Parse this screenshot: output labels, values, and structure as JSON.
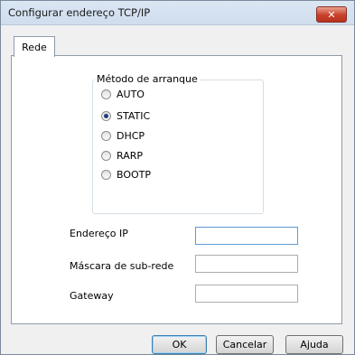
{
  "window": {
    "title": "Configurar endereço TCP/IP",
    "close_label": "✕"
  },
  "tabs": [
    {
      "label": "Rede"
    }
  ],
  "boot_method": {
    "legend": "Método de arranque",
    "options": [
      "AUTO",
      "STATIC",
      "DHCP",
      "RARP",
      "BOOTP"
    ],
    "selected": "STATIC"
  },
  "fields": {
    "ip_label": "Endereço IP",
    "ip_value": "",
    "mask_label": "Máscara de sub-rede",
    "mask_value": "",
    "gateway_label": "Gateway",
    "gateway_value": ""
  },
  "buttons": {
    "ok": "OK",
    "cancel": "Cancelar",
    "help": "Ajuda"
  }
}
